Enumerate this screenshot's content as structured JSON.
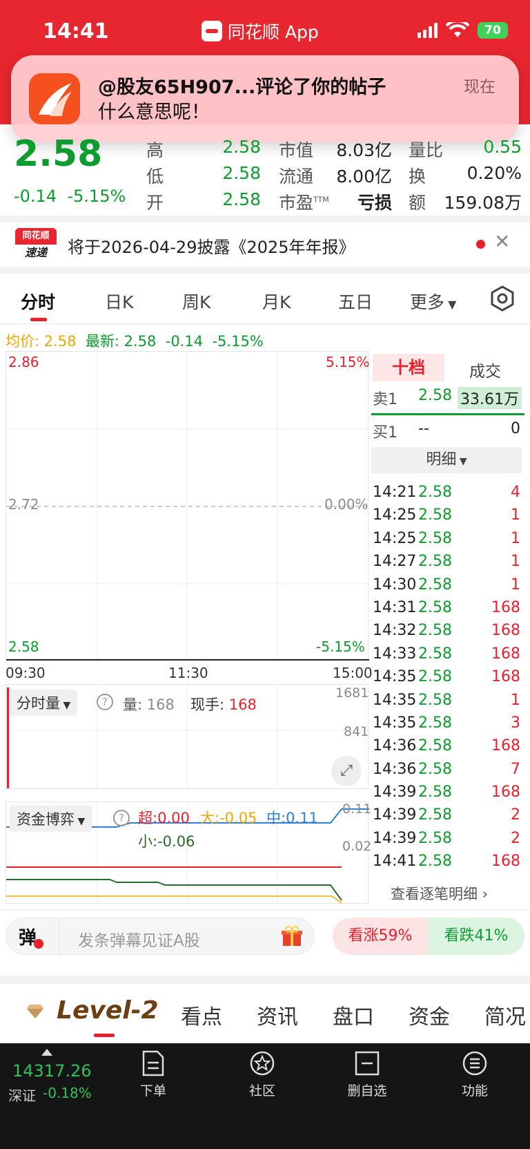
{
  "status": {
    "time": "14:41",
    "app_name": "同花顺 App",
    "battery": "70"
  },
  "notification": {
    "title": "@股友65H907...评论了你的帖子",
    "body": "什么意思呢！",
    "time": "现在"
  },
  "quote": {
    "price": "2.58",
    "change": "-0.14",
    "change_pct": "-5.15%",
    "row1": {
      "l1": "高",
      "v1": "2.58",
      "l2": "市值",
      "v2": "8.03亿",
      "l3": "量比",
      "v3": "0.55"
    },
    "row2": {
      "l1": "低",
      "v1": "2.58",
      "l2": "流通",
      "v2": "8.00亿",
      "l3": "换",
      "v3": "0.20%"
    },
    "row3": {
      "l1": "开",
      "v1": "2.58",
      "l2": "市盈",
      "l2sup": "TTM",
      "v2": "亏损",
      "l3": "额",
      "v3": "159.08万"
    }
  },
  "announcement": {
    "logo_top": "同花顺",
    "logo_bottom": "速递",
    "text": "将于2026-04-29披露《2025年年报》"
  },
  "tabs": [
    "分时",
    "日K",
    "周K",
    "月K",
    "五日",
    "更多"
  ],
  "avg_line": {
    "avg_label": "均价:",
    "avg_value": "2.58",
    "latest_label": "最新:",
    "latest_value": "2.58",
    "change": "-0.14",
    "change_pct": "-5.15%"
  },
  "chart": {
    "y_top": "2.86",
    "y_top_pct": "5.15%",
    "y_mid": "2.72",
    "y_mid_pct": "0.00%",
    "y_bot": "2.58",
    "y_bot_pct": "-5.15%",
    "x_start": "09:30",
    "x_mid": "11:30",
    "x_end": "15:00"
  },
  "volume": {
    "selector": "分时量",
    "vol_label": "量:",
    "vol_value": "168",
    "hand_label": "现手:",
    "hand_value": "168",
    "axis_top": "1681",
    "axis_mid": "841"
  },
  "fund": {
    "selector": "资金博弈",
    "super": "超:0.00",
    "big": "大:-0.05",
    "mid": "中:0.11",
    "small": "小:-0.06",
    "axis_top": "0.11",
    "axis_mid": "0.02"
  },
  "right_panel": {
    "tab_active": "十档",
    "tab_other": "成交",
    "sell1_label": "卖1",
    "sell1_price": "2.58",
    "sell1_vol": "33.61万",
    "buy1_label": "买1",
    "buy1_price": "--",
    "buy1_vol": "0",
    "detail_label": "明细",
    "see_more": "查看逐笔明细 ›",
    "ticks": [
      {
        "t": "14:21",
        "p": "2.58",
        "v": "4"
      },
      {
        "t": "14:25",
        "p": "2.58",
        "v": "1"
      },
      {
        "t": "14:25",
        "p": "2.58",
        "v": "1"
      },
      {
        "t": "14:27",
        "p": "2.58",
        "v": "1"
      },
      {
        "t": "14:30",
        "p": "2.58",
        "v": "1"
      },
      {
        "t": "14:31",
        "p": "2.58",
        "v": "168"
      },
      {
        "t": "14:32",
        "p": "2.58",
        "v": "168"
      },
      {
        "t": "14:33",
        "p": "2.58",
        "v": "168"
      },
      {
        "t": "14:35",
        "p": "2.58",
        "v": "168"
      },
      {
        "t": "14:35",
        "p": "2.58",
        "v": "1"
      },
      {
        "t": "14:35",
        "p": "2.58",
        "v": "3"
      },
      {
        "t": "14:36",
        "p": "2.58",
        "v": "168"
      },
      {
        "t": "14:36",
        "p": "2.58",
        "v": "7"
      },
      {
        "t": "14:39",
        "p": "2.58",
        "v": "168"
      },
      {
        "t": "14:39",
        "p": "2.58",
        "v": "2"
      },
      {
        "t": "14:39",
        "p": "2.58",
        "v": "2"
      },
      {
        "t": "14:41",
        "p": "2.58",
        "v": "168"
      }
    ]
  },
  "danmu": {
    "icon_text": "弹",
    "placeholder": "发条弹幕见证A股",
    "up": "看涨59%",
    "down": "看跌41%"
  },
  "section_tabs": {
    "level2": "Level-2",
    "items": [
      "看点",
      "资讯",
      "盘口",
      "资金",
      "简况"
    ]
  },
  "bottom_bar": {
    "index_value": "14317.26",
    "index_name": "深证",
    "index_change": "-0.18%",
    "nav": [
      "下单",
      "社区",
      "删自选",
      "功能"
    ]
  }
}
